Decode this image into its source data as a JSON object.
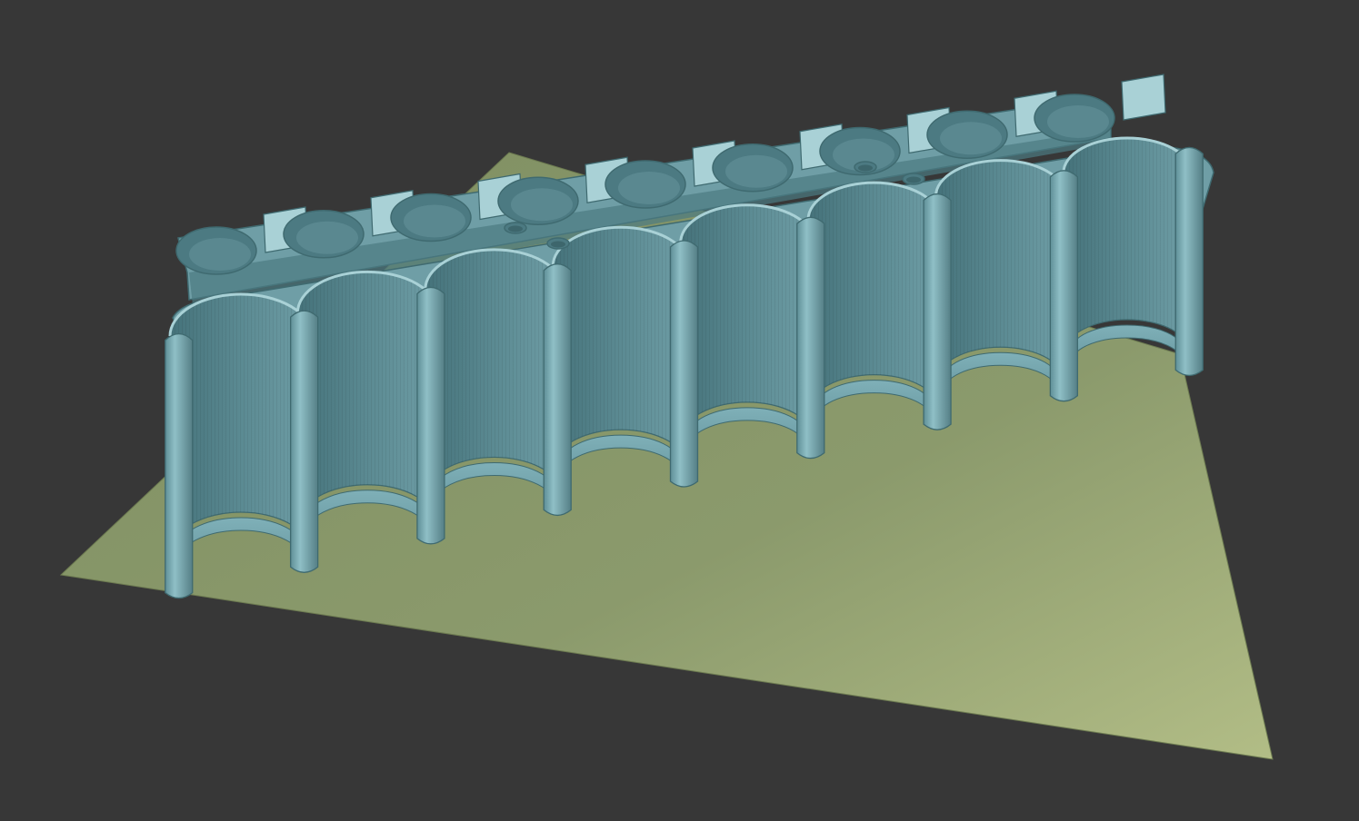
{
  "scene": {
    "background_color": "#373737",
    "build_plate_color": "#8a9a6b",
    "model_color": "#6f9ea6",
    "model_edge_color": "#3f6a70",
    "model_highlight_color": "#a9d1d6",
    "model_shadow_color": "#4c7a82",
    "front_row_cup_count": 8,
    "back_row_cup_count": 9,
    "small_hole_count": 4
  }
}
